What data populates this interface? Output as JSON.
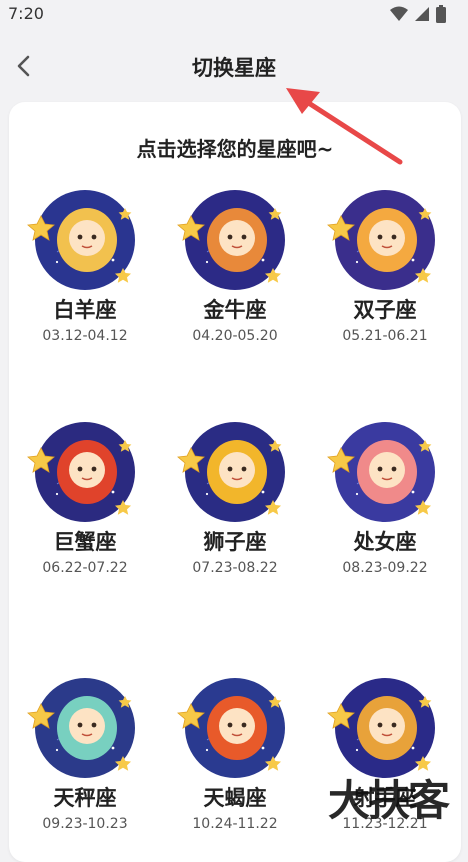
{
  "status": {
    "time": "7:20"
  },
  "header": {
    "title": "切换星座"
  },
  "prompt": "点击选择您的星座吧~",
  "signs": [
    {
      "name": "白羊座",
      "date": "03.12-04.12",
      "color": "#2a3590",
      "accent": "#f2c14e"
    },
    {
      "name": "金牛座",
      "date": "04.20-05.20",
      "color": "#2c2a86",
      "accent": "#e8893a"
    },
    {
      "name": "双子座",
      "date": "05.21-06.21",
      "color": "#3a2e8c",
      "accent": "#f4a940"
    },
    {
      "name": "巨蟹座",
      "date": "06.22-07.22",
      "color": "#2b2a80",
      "accent": "#e0432b"
    },
    {
      "name": "狮子座",
      "date": "07.23-08.22",
      "color": "#2a2c84",
      "accent": "#f2b62b"
    },
    {
      "name": "处女座",
      "date": "08.23-09.22",
      "color": "#3a3aa0",
      "accent": "#f08a8a"
    },
    {
      "name": "天秤座",
      "date": "09.23-10.23",
      "color": "#2b3a8a",
      "accent": "#78d0c0"
    },
    {
      "name": "天蝎座",
      "date": "10.24-11.22",
      "color": "#2a3a90",
      "accent": "#e85a2a"
    },
    {
      "name": "射手座",
      "date": "11.23-12.21",
      "color": "#2a2a88",
      "accent": "#e8a23a"
    }
  ],
  "watermark": "大扶客"
}
